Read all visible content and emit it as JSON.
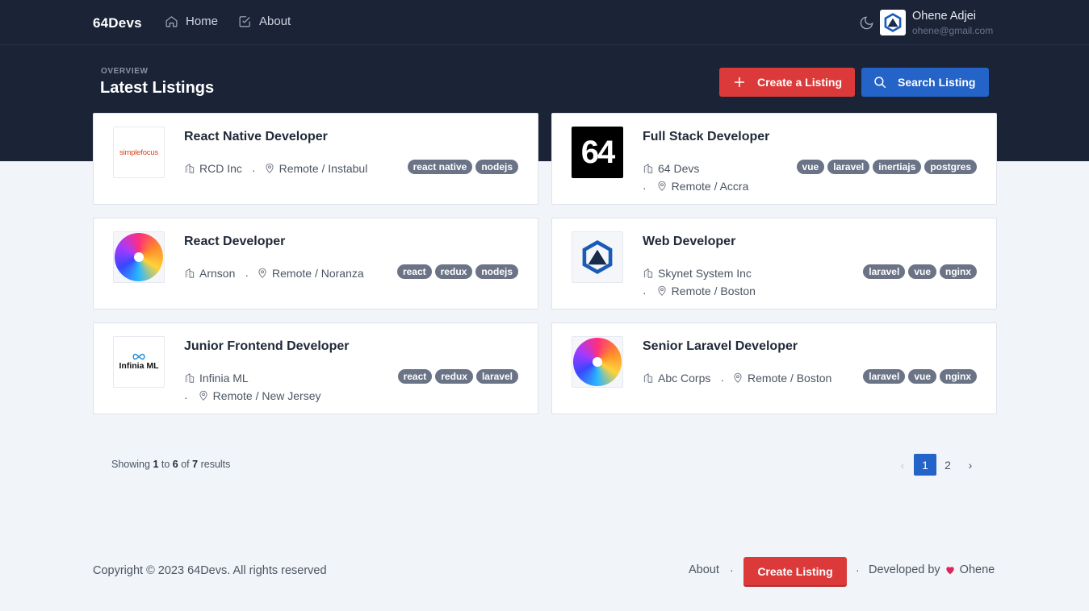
{
  "nav": {
    "brand": "64Devs",
    "links": [
      {
        "label": "Home",
        "icon": "home-icon"
      },
      {
        "label": "About",
        "icon": "checkbox-icon"
      }
    ],
    "theme_icon": "moon-icon",
    "user": {
      "name": "Ohene Adjei",
      "email": "ohene@gmail.com"
    }
  },
  "header": {
    "overline": "OVERVIEW",
    "title": "Latest Listings",
    "create_label": "Create a Listing",
    "search_label": "Search Listing"
  },
  "listings": [
    {
      "title": "React Native Developer",
      "company": "RCD Inc",
      "location": "Remote / Instabul",
      "logo": "simplefocus",
      "logo_text": "simplefocus",
      "tags": [
        "react native",
        "nodejs"
      ]
    },
    {
      "title": "Full Stack Developer",
      "company": "64 Devs",
      "location": "Remote / Accra",
      "logo": "64",
      "logo_text": "64",
      "tags": [
        "vue",
        "laravel",
        "inertiajs",
        "postgres"
      ]
    },
    {
      "title": "React Developer",
      "company": "Arnson",
      "location": "Remote / Noranza",
      "logo": "gradient-circle",
      "tags": [
        "react",
        "redux",
        "nodejs"
      ]
    },
    {
      "title": "Web Developer",
      "company": "Skynet System Inc",
      "location": "Remote / Boston",
      "logo": "skynet-hex",
      "tags": [
        "laravel",
        "vue",
        "nginx"
      ]
    },
    {
      "title": "Junior Frontend Developer",
      "company": "Infinia ML",
      "location": "Remote / New Jersey",
      "logo": "infinia",
      "logo_text": "Infinia ML",
      "tags": [
        "react",
        "redux",
        "laravel"
      ]
    },
    {
      "title": "Senior Laravel Developer",
      "company": "Abc Corps",
      "location": "Remote / Boston",
      "logo": "gradient-circle",
      "tags": [
        "laravel",
        "vue",
        "nginx"
      ]
    }
  ],
  "pagination": {
    "prefix": "Showing",
    "from": "1",
    "to_word": "to",
    "to": "6",
    "of_word": "of",
    "total": "7",
    "suffix": "results",
    "prev": "‹",
    "pages": [
      "1",
      "2"
    ],
    "next": "›",
    "current": "1"
  },
  "footer": {
    "copyright": "Copyright © 2023 64Devs. All rights reserved",
    "about": "About",
    "create": "Create Listing",
    "developed_by": "Developed by",
    "author": "Ohene",
    "heart_color": "#e0245e"
  },
  "colors": {
    "navy": "#1b2337",
    "red": "#dc3a3a",
    "blue": "#2463c7",
    "tag": "#6b7386"
  }
}
